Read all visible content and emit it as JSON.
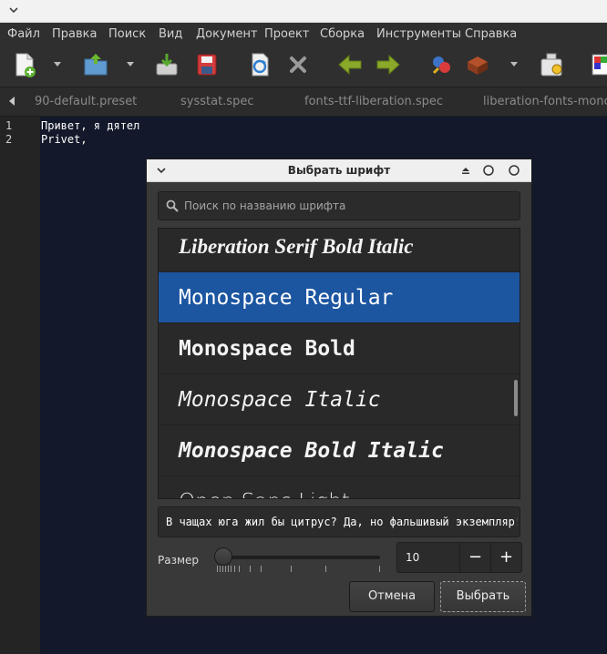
{
  "menubar": {
    "items": [
      "Файл",
      "Правка",
      "Поиск",
      "Вид",
      "Документ",
      "Проект",
      "Сборка",
      "Инструменты",
      "Справка"
    ]
  },
  "toolbar": {
    "icons": [
      "new-file-icon",
      "open-file-icon",
      "save-icon",
      "save-all-icon",
      "reload-icon",
      "close-icon",
      "back-arrow-icon",
      "forward-arrow-icon",
      "compile-icon",
      "build-icon",
      "run-icon",
      "color-chooser-icon"
    ]
  },
  "tabs": [
    "90-default.preset",
    "sysstat.spec",
    "fonts-ttf-liberation.spec",
    "liberation-fonts-mono.co"
  ],
  "editor": {
    "lines": [
      {
        "num": "1",
        "text": "Привет, я дятел"
      },
      {
        "num": "2",
        "text": "Privet,"
      }
    ]
  },
  "dialog": {
    "title": "Выбрать шрифт",
    "search_placeholder": "Поиск по названию шрифта",
    "fonts": [
      "Liberation Serif Bold Italic",
      "Monospace Regular",
      "Monospace Bold",
      "Monospace Italic",
      "Monospace Bold Italic",
      "Open Sans Light"
    ],
    "selected_index": 1,
    "preview_text": "В чащах юга жил бы цитрус? Да, но фальшивый экземпляр!",
    "size_label": "Размер",
    "size_value": "10",
    "minus_label": "−",
    "plus_label": "+",
    "cancel_label": "Отмена",
    "ok_label": "Выбрать"
  },
  "colors": {
    "selection": "#1c55a0",
    "editor_bg": "#13192a",
    "panel_bg": "#2f2f2f"
  }
}
